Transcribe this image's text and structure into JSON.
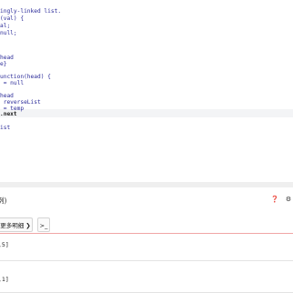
{
  "editor": {
    "lines": [
      "ingly-linked list.",
      "(val) {",
      "al;",
      "null;",
      "",
      "",
      "",
      "head",
      "e}",
      "",
      "unction(head) {",
      " = null",
      "",
      "head",
      " reverseList",
      " = temp",
      ".next",
      "",
      "ist"
    ],
    "current_line": 16
  },
  "panel": {
    "title": "例)",
    "help_icon": "help-icon",
    "settings_icon": "gear-icon",
    "more_info_label": "更多明细 ❯",
    "console_label": ">_",
    "input_value": ",5]",
    "output_value": ",1]"
  }
}
